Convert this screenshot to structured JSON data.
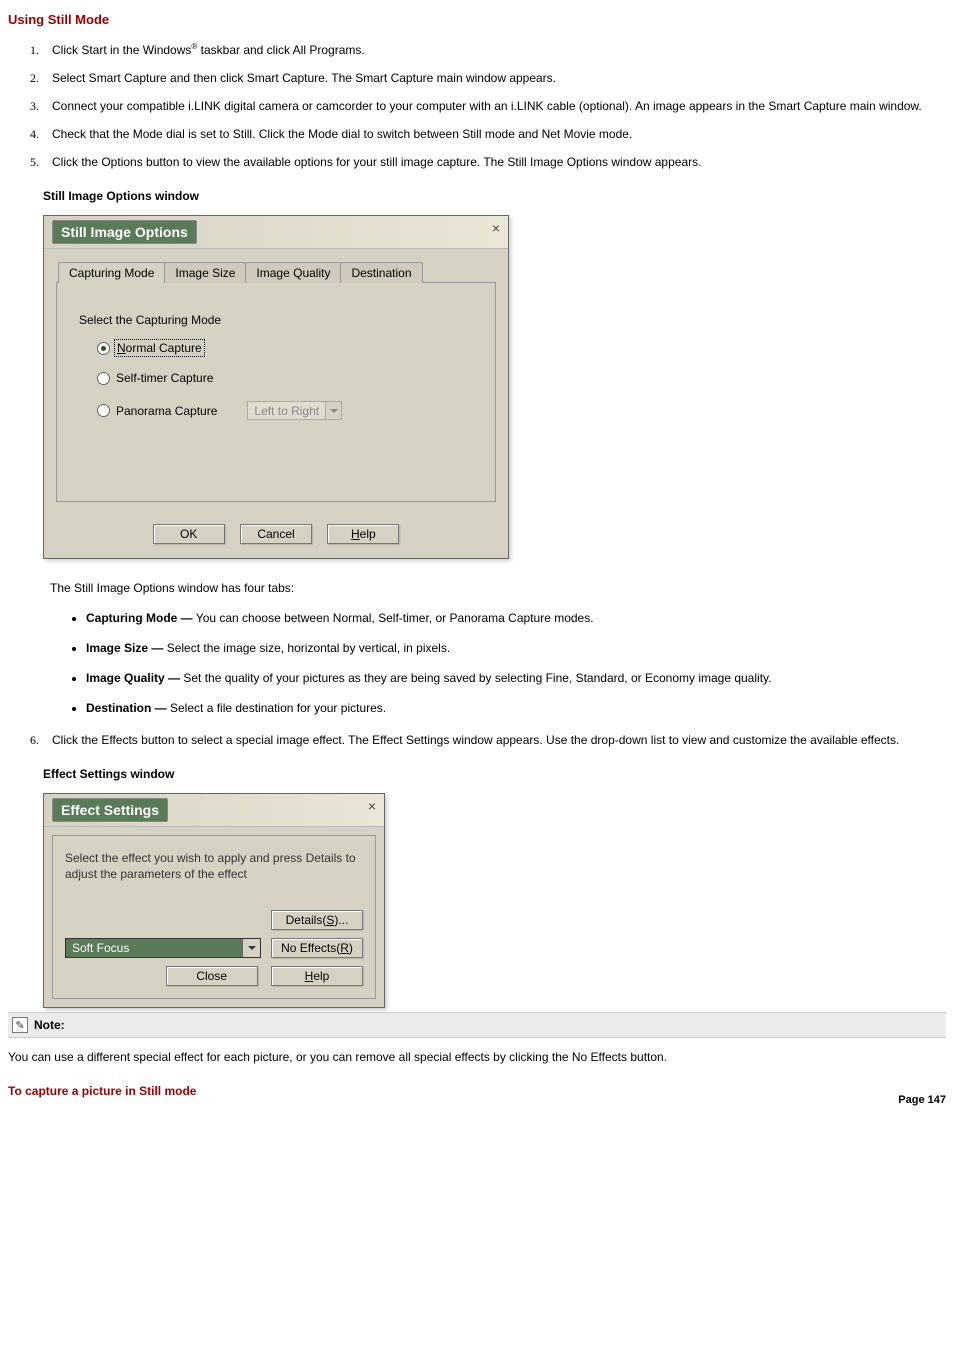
{
  "heading": "Using Still Mode",
  "steps": [
    {
      "pre": "Click Start in the Windows",
      "sup": "®",
      "post": " taskbar and click All Programs."
    },
    {
      "text": "Select Smart Capture and then click Smart Capture. The Smart Capture main window appears."
    },
    {
      "text": "Connect your compatible i.LINK digital camera or camcorder to your computer with an i.LINK cable (optional). An image appears in the Smart Capture main window."
    },
    {
      "text": "Check that the Mode dial is set to Still. Click the Mode dial to switch between Still mode and Net Movie mode."
    },
    {
      "text": "Click the Options button to view the available options for your still image capture. The Still Image Options window appears."
    }
  ],
  "caption1": "Still Image Options window",
  "dlg1": {
    "title": "Still Image Options",
    "tabs": [
      "Capturing Mode",
      "Image Size",
      "Image Quality",
      "Destination"
    ],
    "select_label": "Select the Capturing Mode",
    "radios": {
      "r1": "Normal Capture",
      "r2": "Self-timer Capture",
      "r3": "Panorama Capture"
    },
    "dd_disabled": "Left to Right",
    "ok": "OK",
    "cancel": "Cancel",
    "help_h": "H",
    "help_rest": "elp"
  },
  "intro_tabs": "The Still Image Options window has four tabs:",
  "tab_items": [
    {
      "b": "Capturing Mode —",
      "t": " You can choose between Normal, Self-timer, or Panorama Capture modes."
    },
    {
      "b": "Image Size —",
      "t": " Select the image size, horizontal by vertical, in pixels."
    },
    {
      "b": "Image Quality —",
      "t": " Set the quality of your pictures as they are being saved by selecting Fine, Standard, or Economy image quality."
    },
    {
      "b": "Destination —",
      "t": " Select a file destination for your pictures."
    }
  ],
  "step6": "Click the Effects button to select a special image effect. The Effect Settings window appears. Use the drop-down list to view and customize the available effects.",
  "caption2": "Effect Settings window",
  "dlg2": {
    "title": "Effect Settings",
    "desc": "Select the effect you wish to apply and press Details to adjust the parameters of the effect",
    "details_pre": "Details(",
    "details_u": "S",
    "details_post": ")...",
    "dd_value": "Soft Focus",
    "noeff_pre": "No Effects(",
    "noeff_u": "R",
    "noeff_post": ")",
    "close": "Close",
    "help_h": "H",
    "help_rest": "elp"
  },
  "note_label": "Note:",
  "note_body": "You can use a different special effect for each picture, or you can remove all special effects by clicking the No Effects button.",
  "footer_heading": "To capture a picture in Still mode",
  "page_num": "Page 147"
}
